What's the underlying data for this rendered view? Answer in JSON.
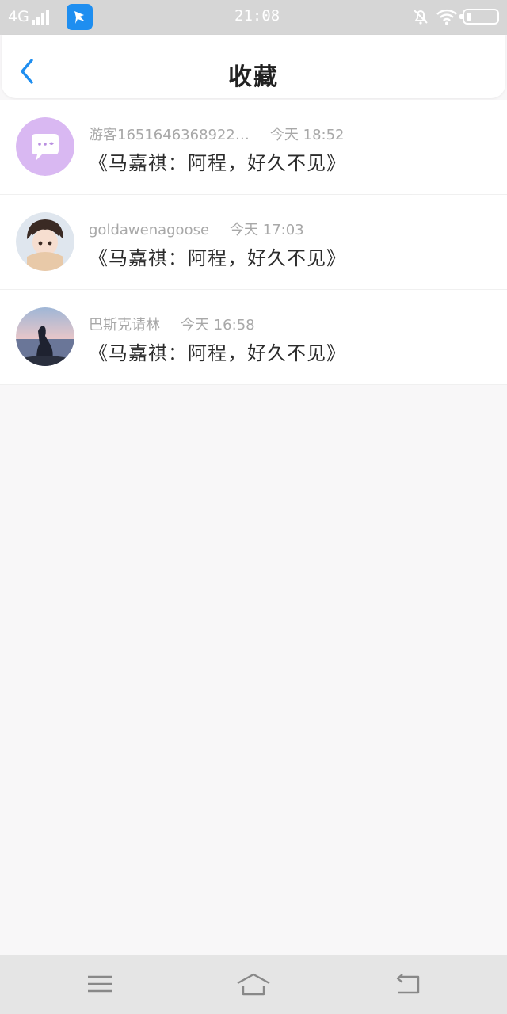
{
  "status_bar": {
    "network": "4G",
    "time": "21:08"
  },
  "header": {
    "title": "收藏"
  },
  "favorites": [
    {
      "author": "游客1651646368922…",
      "time": "今天 18:52",
      "title": "《马嘉祺：阿程，好久不见》"
    },
    {
      "author": "goldawenagoose",
      "time": "今天 17:03",
      "title": "《马嘉祺：阿程，好久不见》"
    },
    {
      "author": "巴斯克请林",
      "time": "今天 16:58",
      "title": "《马嘉祺：阿程，好久不见》"
    }
  ],
  "icons": {
    "app_icon": "bird-app-icon",
    "back": "chevron-left-icon",
    "nav_menu": "menu-icon",
    "nav_home": "home-icon",
    "nav_back": "return-icon"
  },
  "colors": {
    "accent": "#1e8ef0",
    "avatar_default": "#d9b8f2"
  }
}
